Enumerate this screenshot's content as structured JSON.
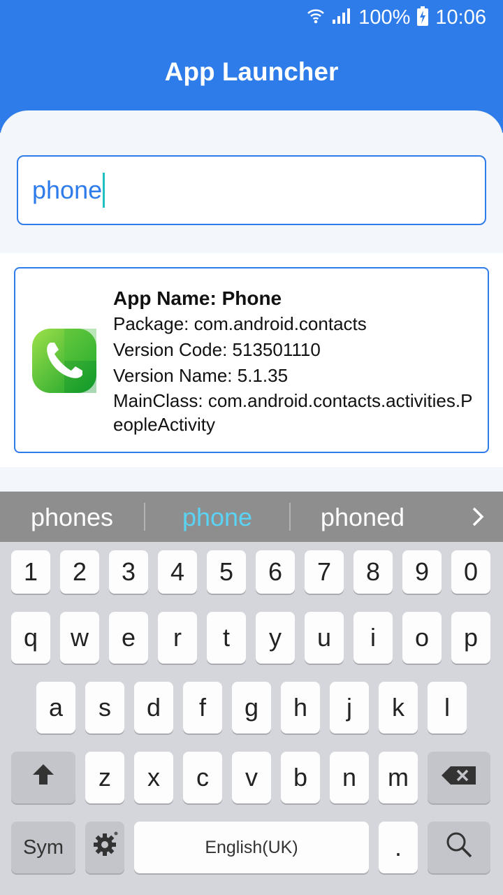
{
  "status_bar": {
    "battery": "100%",
    "time": "10:06",
    "icons": [
      "wifi-icon",
      "signal-icon",
      "battery-charging-icon"
    ]
  },
  "header": {
    "title": "App Launcher"
  },
  "search": {
    "value": "phone"
  },
  "app_card": {
    "name_line": "App Name: Phone",
    "package_line": "Package: com.android.contacts",
    "version_code_line": "Version Code: 513501110",
    "version_name_line": "Version Name: 5.1.35",
    "main_class_line": "MainClass: com.android.contacts.activities.PeopleActivity"
  },
  "keyboard": {
    "suggestions": [
      "phones",
      "phone",
      "phoned"
    ],
    "num_row": [
      "1",
      "2",
      "3",
      "4",
      "5",
      "6",
      "7",
      "8",
      "9",
      "0"
    ],
    "row1": [
      "q",
      "w",
      "e",
      "r",
      "t",
      "y",
      "u",
      "i",
      "o",
      "p"
    ],
    "row2": [
      "a",
      "s",
      "d",
      "f",
      "g",
      "h",
      "j",
      "k",
      "l"
    ],
    "row3": [
      "z",
      "x",
      "c",
      "v",
      "b",
      "n",
      "m"
    ],
    "sym_label": "Sym",
    "space_label": "English(UK)",
    "period_label": ".",
    "colors": {
      "accent": "#2e7bea",
      "highlight_suggestion": "#5ad3f5"
    }
  }
}
